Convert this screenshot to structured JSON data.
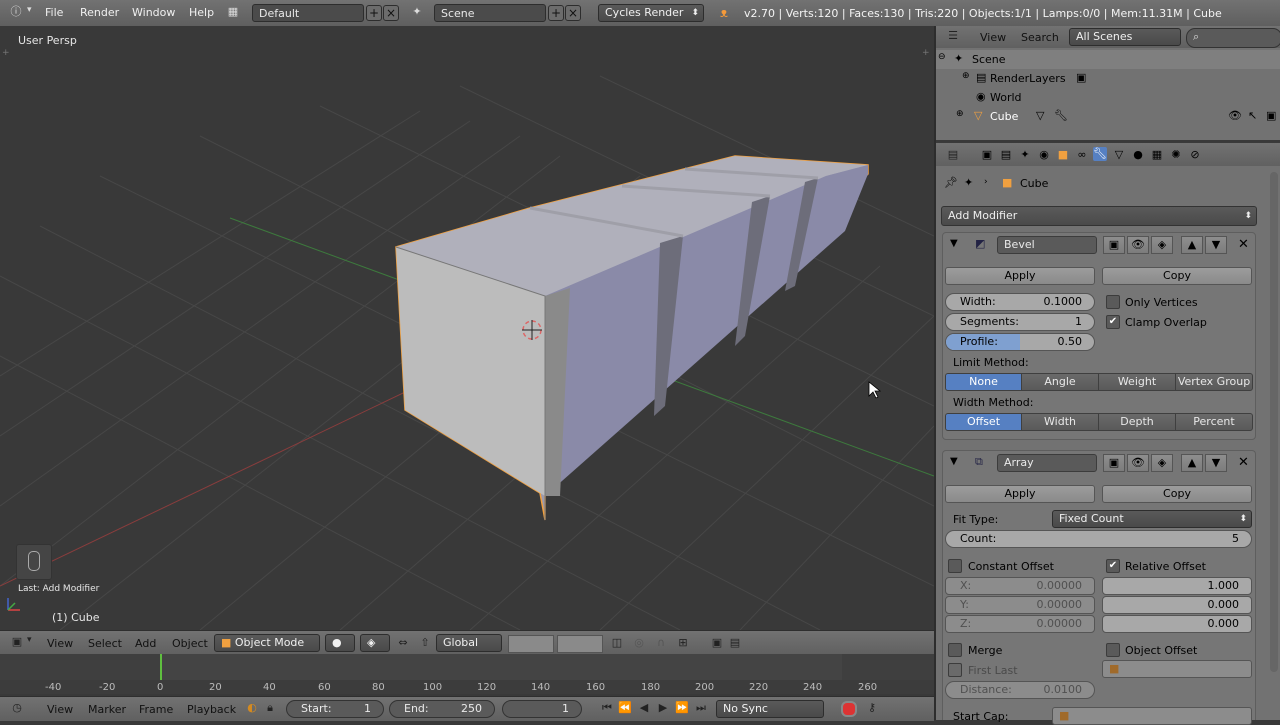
{
  "topbar": {
    "menus": [
      "File",
      "Render",
      "Window",
      "Help"
    ],
    "layout": "Default",
    "scene": "Scene",
    "engine": "Cycles Render",
    "stats": "v2.70 | Verts:120 | Faces:130 | Tris:220 | Objects:1/1 | Lamps:0/0 | Mem:11.31M | Cube"
  },
  "viewport": {
    "view_name": "User Persp",
    "last_op": "Last: Add Modifier",
    "object_label": "(1) Cube"
  },
  "view3d_header": {
    "menus": [
      "View",
      "Select",
      "Add",
      "Object"
    ],
    "mode": "Object Mode",
    "orientation": "Global"
  },
  "timeline": {
    "ticks": [
      "-40",
      "-20",
      "0",
      "20",
      "40",
      "60",
      "80",
      "100",
      "120",
      "140",
      "160",
      "180",
      "200",
      "220",
      "240",
      "260"
    ],
    "menus": [
      "View",
      "Marker",
      "Frame",
      "Playback"
    ],
    "start_label": "Start:",
    "start_value": "1",
    "end_label": "End:",
    "end_value": "250",
    "current_frame": "1",
    "sync": "No Sync"
  },
  "outliner": {
    "menus": [
      "View",
      "Search"
    ],
    "scenes_dropdown": "All Scenes",
    "items": [
      "Scene",
      "RenderLayers",
      "World",
      "Cube"
    ]
  },
  "properties": {
    "breadcrumb_object": "Cube",
    "add_modifier": "Add Modifier",
    "bevel": {
      "name": "Bevel",
      "apply": "Apply",
      "copy": "Copy",
      "width_label": "Width:",
      "width_value": "0.1000",
      "segments_label": "Segments:",
      "segments_value": "1",
      "profile_label": "Profile:",
      "profile_value": "0.50",
      "profile_fraction": 0.5,
      "only_vertices": "Only Vertices",
      "only_vertices_checked": false,
      "clamp_overlap": "Clamp Overlap",
      "clamp_overlap_checked": true,
      "limit_method_label": "Limit Method:",
      "limit_methods": [
        "None",
        "Angle",
        "Weight",
        "Vertex Group"
      ],
      "limit_selected": "None",
      "width_method_label": "Width Method:",
      "width_methods": [
        "Offset",
        "Width",
        "Depth",
        "Percent"
      ],
      "width_selected": "Offset"
    },
    "array": {
      "name": "Array",
      "apply": "Apply",
      "copy": "Copy",
      "fit_type_label": "Fit Type:",
      "fit_type": "Fixed Count",
      "count_label": "Count:",
      "count_value": "5",
      "constant_offset": "Constant Offset",
      "constant_offset_checked": false,
      "relative_offset": "Relative Offset",
      "relative_offset_checked": true,
      "const_x_label": "X:",
      "const_x": "0.00000",
      "const_y_label": "Y:",
      "const_y": "0.00000",
      "const_z_label": "Z:",
      "const_z": "0.00000",
      "rel_x": "1.000",
      "rel_y": "0.000",
      "rel_z": "0.000",
      "merge": "Merge",
      "merge_checked": false,
      "object_offset": "Object Offset",
      "object_offset_checked": false,
      "first_last": "First Last",
      "distance_label": "Distance:",
      "distance_value": "0.0100",
      "start_cap_label": "Start Cap:"
    }
  },
  "colors": {
    "accent": "#5680c2",
    "selection_outline": "#f0a040",
    "background": "#393939"
  }
}
